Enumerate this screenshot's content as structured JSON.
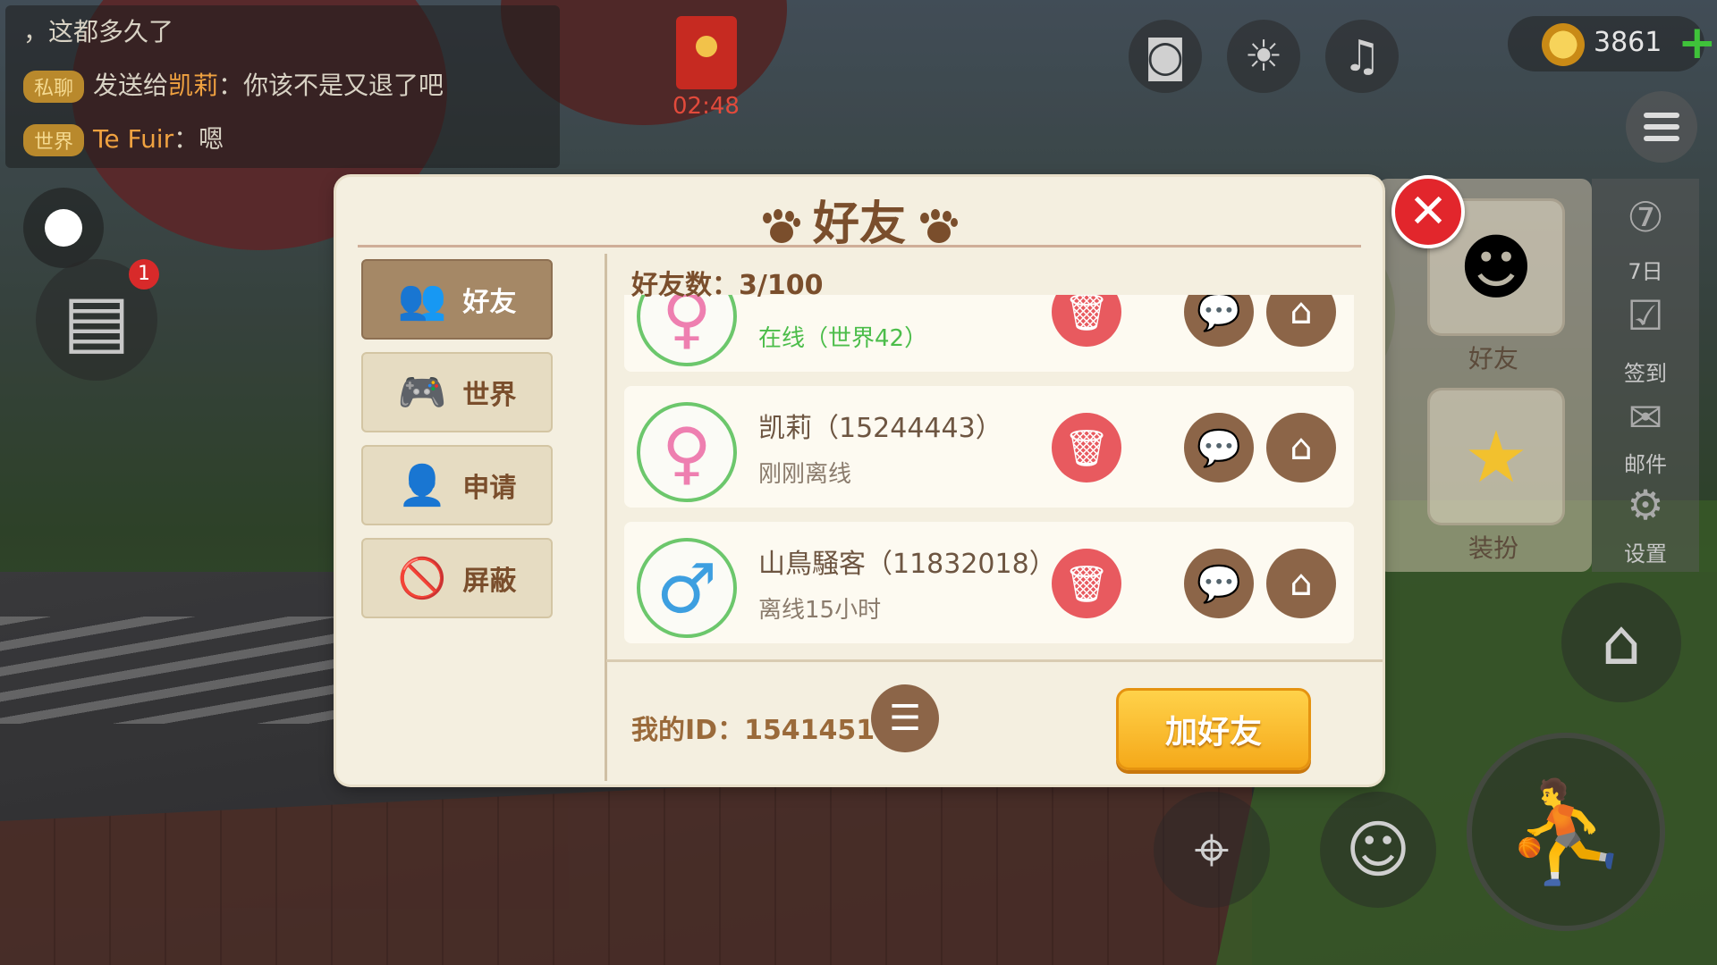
{
  "chat": {
    "line1": "，这都多久了",
    "line2_tag": "私聊",
    "line2_prefix": "发送给",
    "line2_name": "凯莉",
    "line2_text": "：你该不是又退了吧",
    "line3_tag": "世界",
    "line3_name": "Te Fuir",
    "line3_text": "：嗯"
  },
  "event_timer": "02:48",
  "coins": "3861",
  "task_badge": "1",
  "right_panel": {
    "friends_label": "好友",
    "dressup_label": "装扮",
    "sidebar": [
      "7日",
      "签到",
      "邮件",
      "设置"
    ]
  },
  "dialog": {
    "title": "好友",
    "tabs": [
      {
        "label": "好友",
        "icon": "friends-icon",
        "active": true
      },
      {
        "label": "世界",
        "icon": "gamepad-icon",
        "active": false
      },
      {
        "label": "申请",
        "icon": "add-user-icon",
        "active": false
      },
      {
        "label": "屏蔽",
        "icon": "block-user-icon",
        "active": false
      }
    ],
    "friend_count": "好友数：3/100",
    "friends": [
      {
        "name": "",
        "status": "在线（世界42）",
        "gender": "female",
        "online": true
      },
      {
        "name": "凯莉（15244443）",
        "status": "刚刚离线",
        "gender": "female",
        "online": false
      },
      {
        "name": "山鳥騒客（11832018）",
        "status": "离线15小时",
        "gender": "male",
        "online": false
      }
    ],
    "my_id": "我的ID：15414518",
    "add_friend_label": "加好友"
  },
  "colors": {
    "dialog_bg": "#f4efe0",
    "accent_brown": "#7a4e2c",
    "delete_red": "#e85a5f",
    "online_green": "#4cbd4a",
    "add_button_gold": "#f5a91a"
  }
}
